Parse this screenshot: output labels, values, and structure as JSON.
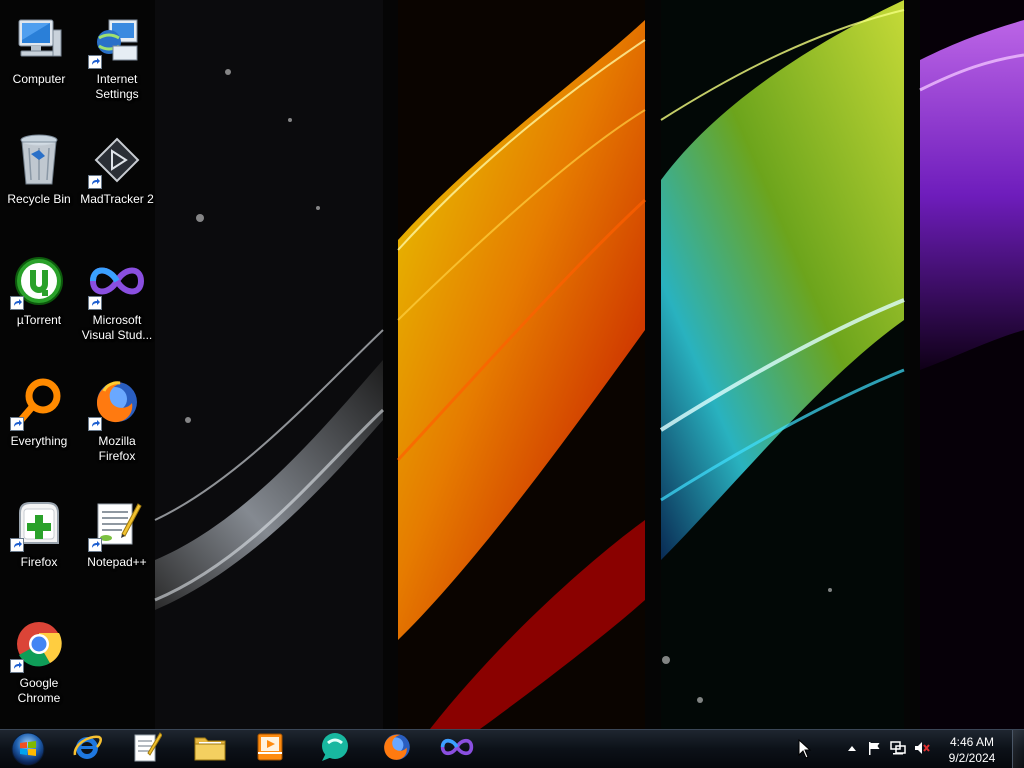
{
  "desktop": {
    "icons": [
      {
        "label": "Computer",
        "icon": "computer-icon",
        "shortcut": false
      },
      {
        "label": "Internet\nSettings",
        "icon": "internet-settings-icon",
        "shortcut": true
      },
      {
        "label": "Recycle Bin",
        "icon": "recycle-bin-icon",
        "shortcut": false
      },
      {
        "label": "MadTracker 2",
        "icon": "madtracker-icon",
        "shortcut": true
      },
      {
        "label": "µTorrent",
        "icon": "utorrent-icon",
        "shortcut": true
      },
      {
        "label": "Microsoft\nVisual Stud...",
        "icon": "visual-studio-icon",
        "shortcut": true
      },
      {
        "label": "Everything",
        "icon": "everything-icon",
        "shortcut": true
      },
      {
        "label": "Mozilla\nFirefox",
        "icon": "firefox-icon",
        "shortcut": true
      },
      {
        "label": "Firefox",
        "icon": "firefox-installer-icon",
        "shortcut": true
      },
      {
        "label": "Notepad++",
        "icon": "notepadpp-icon",
        "shortcut": true
      },
      {
        "label": "Google\nChrome",
        "icon": "chrome-icon",
        "shortcut": true
      }
    ]
  },
  "taskbar": {
    "start_icon": "windows-start-orb-icon",
    "pinned": [
      {
        "icon": "internet-explorer-icon"
      },
      {
        "icon": "notepad-icon"
      },
      {
        "icon": "file-explorer-icon"
      },
      {
        "icon": "media-player-icon"
      },
      {
        "icon": "chat-app-icon"
      },
      {
        "icon": "firefox-icon"
      },
      {
        "icon": "visual-studio-icon"
      }
    ],
    "tray": {
      "icons": [
        "show-hidden-icons-chevron-icon",
        "action-center-flag-icon",
        "network-icon",
        "volume-muted-icon"
      ],
      "time": "4:46 AM",
      "date": "9/2/2024"
    }
  },
  "colors": {
    "taskbar_bg": "#0c1118",
    "accent_orange": "#ff8a00",
    "accent_green": "#b8e83a",
    "accent_purple": "#9a3cff"
  }
}
